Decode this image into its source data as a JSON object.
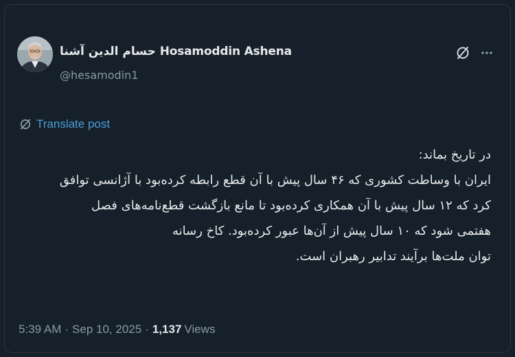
{
  "author": {
    "display_name": "حسام الدین آشنا Hosamoddin Ashena",
    "handle": "@hesamodin1",
    "avatar_icon": "profile-photo"
  },
  "actions": {
    "grok_icon": "grok-icon",
    "more_icon": "more-horizontal-icon"
  },
  "translate": {
    "label": "Translate post",
    "icon": "translate-icon",
    "color": "#4c9fd8"
  },
  "post": {
    "lines": [
      "در تاریخ بماند:",
      "ایران با وساطت کشوری که ۴۶ سال پیش با آن قطع رابطه کرده‌بود با آژانسی توافق",
      "کرد که ۱۲ سال پیش با آن همکاری کرده‌بود تا مانع بازگشت قطع‌نامه‌های فصل",
      "هفتمی شود که ۱۰ سال پیش از آن‌ها عبور کرده‌بود. کاخ رسانه",
      "توان ملت‌ها برآیند تدابیر رهبران است."
    ]
  },
  "meta": {
    "time": "5:39 AM",
    "separator": "·",
    "date": "Sep 10, 2025",
    "views_count": "1,137",
    "views_label": "Views"
  },
  "colors": {
    "background": "#15202b",
    "text": "#e7e9ea",
    "secondary": "#8b98a5",
    "link": "#4c9fd8"
  }
}
